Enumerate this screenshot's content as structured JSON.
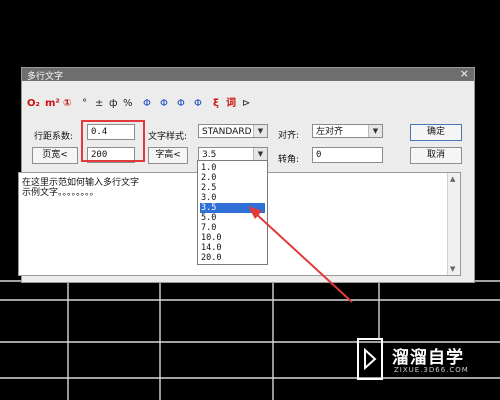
{
  "dialog": {
    "title": "多行文字",
    "close_glyph": "×"
  },
  "toolbar": [
    {
      "name": "subscript-O2",
      "glyph": "O₂",
      "color": "#c11"
    },
    {
      "name": "superscript-m2",
      "glyph": "m²",
      "color": "#c11"
    },
    {
      "name": "circled-one",
      "glyph": "①",
      "color": "#c11"
    },
    {
      "name": "degree",
      "glyph": "°",
      "color": "#222"
    },
    {
      "name": "plus-minus",
      "glyph": "±",
      "color": "#222"
    },
    {
      "name": "diameter",
      "glyph": "ф",
      "color": "#222"
    },
    {
      "name": "percent",
      "glyph": "%",
      "color": "#222"
    },
    {
      "name": "steel-grade-1",
      "glyph": "Φ",
      "color": "#1a46c8"
    },
    {
      "name": "steel-grade-2",
      "glyph": "Φ",
      "color": "#1a46c8"
    },
    {
      "name": "steel-grade-3",
      "glyph": "Φ",
      "color": "#1a46c8"
    },
    {
      "name": "steel-grade-4",
      "glyph": "Φ",
      "color": "#1a46c8"
    },
    {
      "name": "special-char",
      "glyph": "ξ",
      "color": "#c11"
    },
    {
      "name": "word-lib",
      "glyph": "词",
      "color": "#c11"
    },
    {
      "name": "pick-cursor",
      "glyph": "⊳",
      "color": "#222"
    }
  ],
  "form": {
    "line_spacing_label": "行距系数:",
    "line_spacing_value": "0.4",
    "page_width_button": "页宽<",
    "page_width_value": "200",
    "text_style_label": "文字样式:",
    "text_style_value": "STANDARD",
    "char_height_button": "字高<",
    "char_height_value": "3.5",
    "align_label": "对齐:",
    "align_value": "左对齐",
    "rotate_label": "转角:",
    "rotate_value": "0",
    "ok_button": "确定",
    "cancel_button": "取消"
  },
  "textarea": {
    "line1": "在这里示范如何输入多行文字",
    "line2": "示例文字。。。。。。。。"
  },
  "height_options": [
    "1.0",
    "2.0",
    "2.5",
    "3.0",
    "3.5",
    "5.0",
    "7.0",
    "10.0",
    "14.0",
    "20.0"
  ],
  "selected_height_index": 4,
  "watermark": {
    "brand": "溜溜自学",
    "domain": "ZIXUE.3D66.COM"
  },
  "colors": {
    "annotation_red": "#e23a3a",
    "selection_blue": "#2f6fd6"
  }
}
